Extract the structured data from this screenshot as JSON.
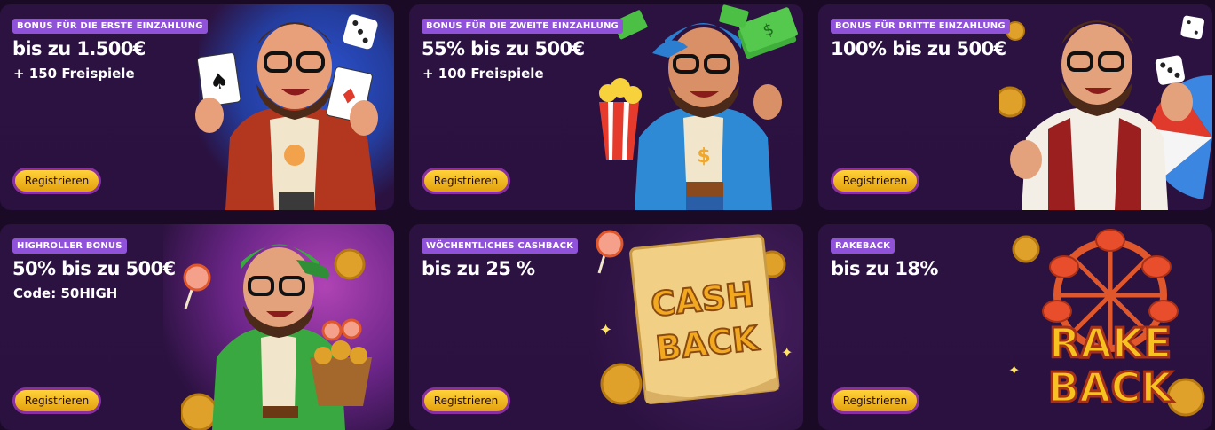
{
  "cards": [
    {
      "badge": "BONUS FÜR DIE ERSTE EINZAHLUNG",
      "title": "bis zu 1.500€",
      "subtitle": "+ 150 Freispiele",
      "button": "Registrieren",
      "art": "cards-man-illustration"
    },
    {
      "badge": "BONUS FÜR DIE ZWEITE EINZAHLUNG",
      "title": "55% bis zu 500€",
      "subtitle": "+ 100 Freispiele",
      "button": "Registrieren",
      "art": "popcorn-money-man-illustration"
    },
    {
      "badge": "BONUS FÜR DRITTE EINZAHLUNG",
      "title": "100% bis zu 500€",
      "subtitle": "",
      "button": "Registrieren",
      "art": "dice-wheel-man-illustration"
    },
    {
      "badge": "HIGHROLLER BONUS",
      "title": "50% bis zu 500€",
      "subtitle": "Code: 50HIGH",
      "button": "Registrieren",
      "art": "coin-basket-man-illustration"
    },
    {
      "badge": "WÖCHENTLICHES CASHBACK",
      "title": "bis zu 25 %",
      "subtitle": "",
      "button": "Registrieren",
      "art": "cashback-illustration",
      "art_text": [
        "CASH",
        "BACK"
      ]
    },
    {
      "badge": "RAKEBACK",
      "title": "bis zu 18%",
      "subtitle": "",
      "button": "Registrieren",
      "art": "rakeback-illustration",
      "art_text": [
        "RAKE",
        "BACK"
      ]
    }
  ],
  "colors": {
    "background": "#1b0a26",
    "card": "#2c1240",
    "badge": "#8f52d9",
    "button": "#f5c11f",
    "button_border": "#8a2f9f"
  }
}
